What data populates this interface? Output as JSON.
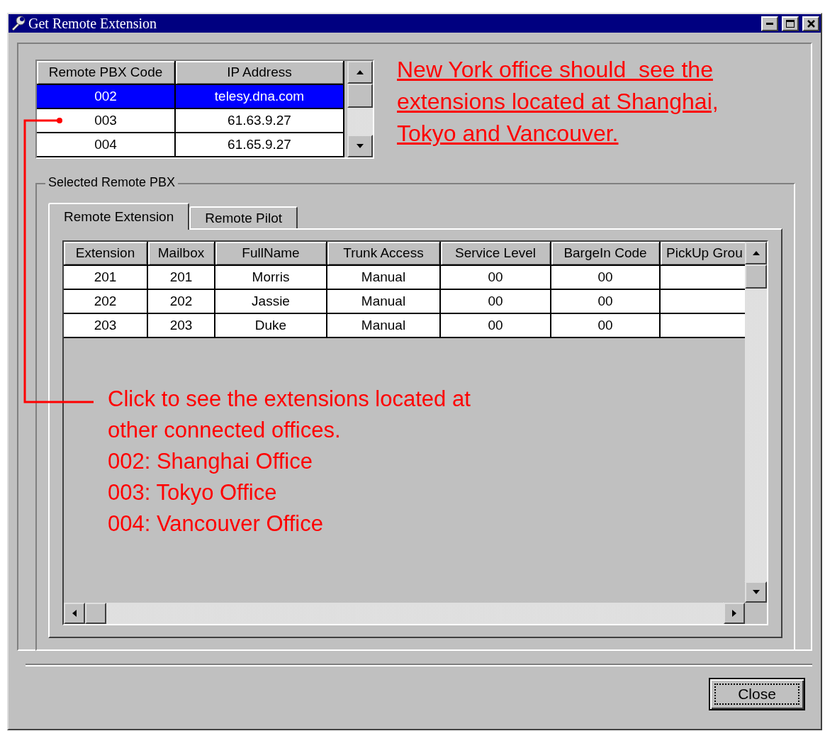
{
  "window": {
    "title": "Get Remote Extension"
  },
  "pbx_table": {
    "columns": [
      "Remote PBX Code",
      "IP Address"
    ],
    "rows": [
      {
        "code": "002",
        "ip": "telesy.dna.com",
        "selected": true
      },
      {
        "code": "003",
        "ip": "61.63.9.27",
        "selected": false
      },
      {
        "code": "004",
        "ip": "61.65.9.27",
        "selected": false
      }
    ]
  },
  "top_note": [
    "New York office should  see the",
    "extensions located at Shanghai,",
    "Tokyo and Vancouver."
  ],
  "group_label": "Selected Remote PBX",
  "tabs": [
    {
      "label": "Remote Extension",
      "selected": true
    },
    {
      "label": "Remote Pilot",
      "selected": false
    }
  ],
  "extension_grid": {
    "columns": [
      "Extension",
      "Mailbox",
      "FullName",
      "Trunk Access",
      "Service Level",
      "BargeIn Code",
      "PickUp Grou"
    ],
    "rows": [
      [
        "201",
        "201",
        "Morris",
        "Manual",
        "00",
        "00"
      ],
      [
        "202",
        "202",
        "Jassie",
        "Manual",
        "00",
        "00"
      ],
      [
        "203",
        "203",
        "Duke",
        "Manual",
        "00",
        "00"
      ]
    ]
  },
  "bottom_note": [
    "Click to see the extensions located at",
    "other connected offices.",
    "002: Shanghai Office",
    "003: Tokyo Office",
    "004: Vancouver Office"
  ],
  "close_button": "Close"
}
